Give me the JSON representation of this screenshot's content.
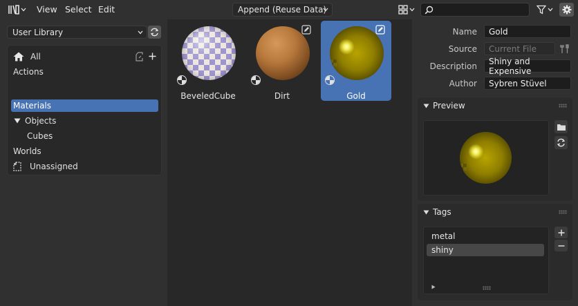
{
  "colors": {
    "accent": "#4772b3",
    "header_bg": "#303030",
    "panel_bg": "#282828"
  },
  "header": {
    "editor_icon": "asset-browser-icon",
    "menus": [
      "View",
      "Select",
      "Edit"
    ],
    "import_mode": "Append (Reuse Data)",
    "search": {
      "value": "",
      "placeholder": ""
    }
  },
  "sidebar": {
    "library": "User Library",
    "catalogs": [
      {
        "label": "All",
        "icon": "home-icon",
        "indent": 0,
        "selected": false
      },
      {
        "label": "Actions",
        "indent": 0,
        "selected": false
      },
      {
        "label": "Materials",
        "indent": 0,
        "selected": true
      },
      {
        "label": "Objects",
        "indent": 0,
        "expanded": true,
        "selected": false
      },
      {
        "label": "Cubes",
        "indent": 1,
        "selected": false
      },
      {
        "label": "Worlds",
        "indent": 0,
        "selected": false
      },
      {
        "label": "Unassigned",
        "icon": "unassigned-icon",
        "indent": 0,
        "selected": false
      }
    ]
  },
  "assets": [
    {
      "name": "BeveledCube",
      "preview": "checker-sphere",
      "selected": false,
      "editable": false
    },
    {
      "name": "Dirt",
      "preview": "dirt-sphere",
      "selected": false,
      "editable": true
    },
    {
      "name": "Gold",
      "preview": "gold-sphere",
      "selected": true,
      "editable": true
    }
  ],
  "properties": {
    "name_label": "Name",
    "name_value": "Gold",
    "source_label": "Source",
    "source_value": "Current File",
    "description_label": "Description",
    "description_value": "Shiny and Expensive",
    "author_label": "Author",
    "author_value": "Sybren Stüvel"
  },
  "preview_panel": {
    "title": "Preview"
  },
  "tags_panel": {
    "title": "Tags",
    "tags": [
      "metal",
      "shiny"
    ],
    "selected_tag": "shiny"
  }
}
